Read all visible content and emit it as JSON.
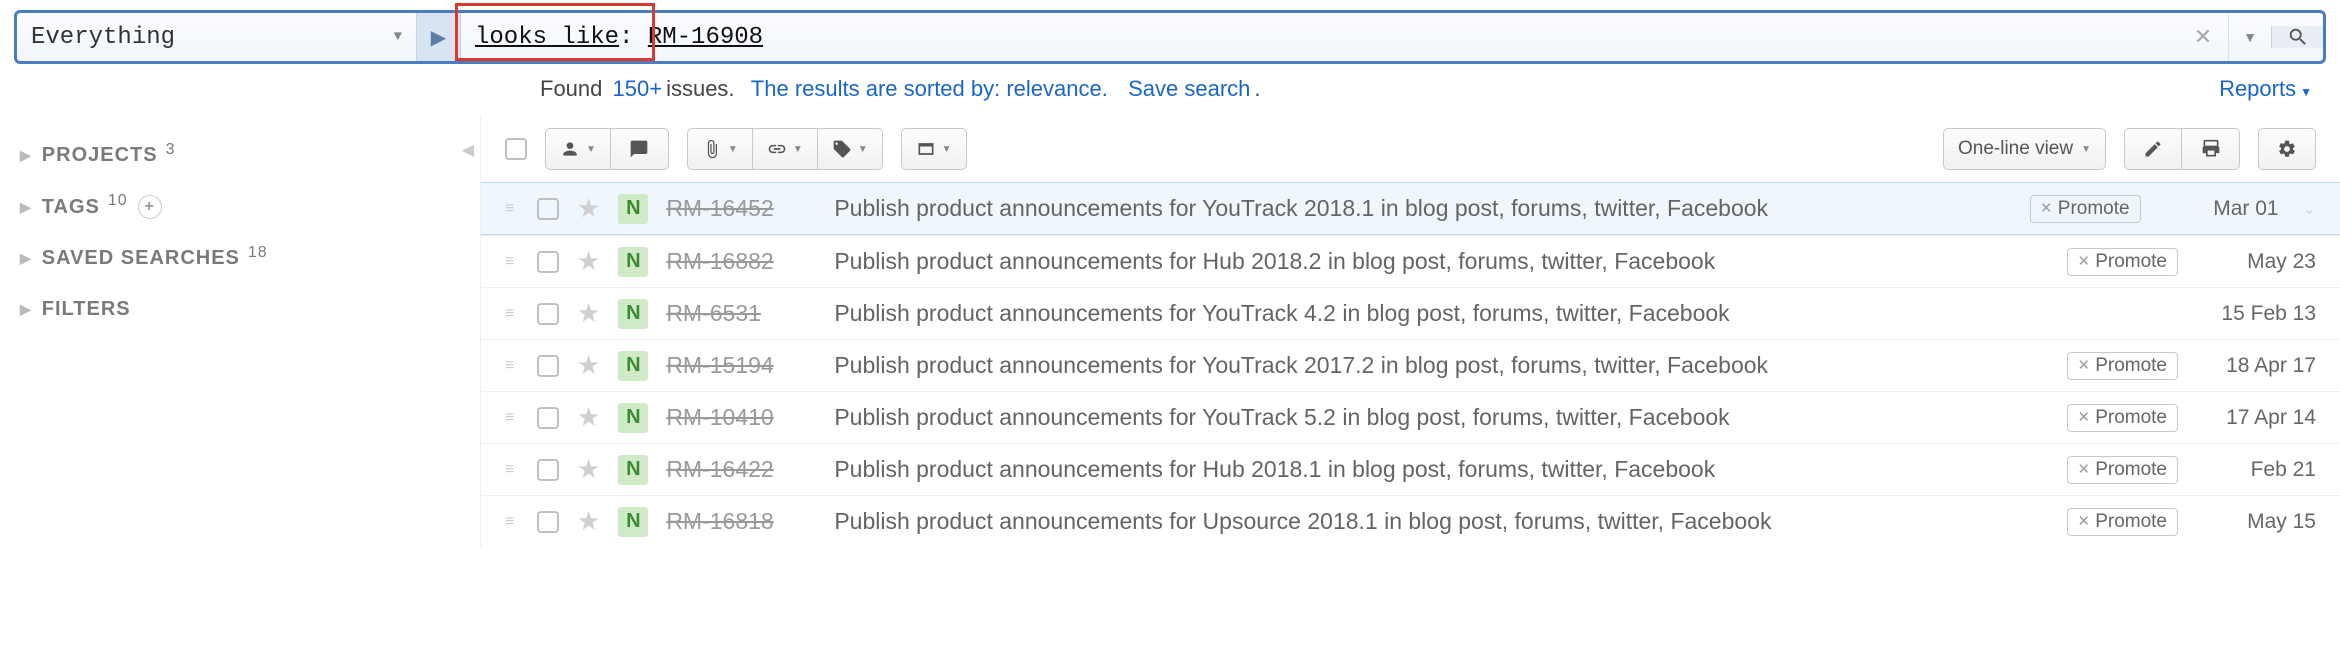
{
  "search": {
    "scope": "Everything",
    "query_operator": "looks like",
    "query_separator": ":",
    "query_value": "RM-16908"
  },
  "summary": {
    "prefix": "Found",
    "count": "150+",
    "count_suffix": "issues.",
    "sorted_text": "The results are sorted by: relevance.",
    "save_search": "Save search",
    "reports": "Reports"
  },
  "sidebar": {
    "sections": [
      {
        "label": "PROJECTS",
        "count": "3"
      },
      {
        "label": "TAGS",
        "count": "10",
        "add": true
      },
      {
        "label": "SAVED SEARCHES",
        "count": "18"
      },
      {
        "label": "FILTERS",
        "count": ""
      }
    ]
  },
  "toolbar": {
    "view_label": "One-line view"
  },
  "issues": [
    {
      "id": "RM-16452",
      "title": "Publish product announcements for YouTrack 2018.1 in blog post, forums, twitter, Facebook",
      "tag": "Promote",
      "date": "Mar 01",
      "selected": true
    },
    {
      "id": "RM-16882",
      "title": "Publish product announcements for Hub 2018.2 in blog post, forums, twitter, Facebook",
      "tag": "Promote",
      "date": "May 23"
    },
    {
      "id": "RM-6531",
      "title": "Publish product announcements for YouTrack 4.2 in blog post, forums, twitter, Facebook",
      "tag": "",
      "date": "15 Feb 13"
    },
    {
      "id": "RM-15194",
      "title": "Publish product announcements for YouTrack 2017.2 in blog post, forums, twitter, Facebook",
      "tag": "Promote",
      "date": "18 Apr 17"
    },
    {
      "id": "RM-10410",
      "title": "Publish product announcements for YouTrack 5.2 in blog post, forums, twitter, Facebook",
      "tag": "Promote",
      "date": "17 Apr 14"
    },
    {
      "id": "RM-16422",
      "title": "Publish product announcements for Hub 2018.1 in blog post, forums, twitter, Facebook",
      "tag": "Promote",
      "date": "Feb 21"
    },
    {
      "id": "RM-16818",
      "title": "Publish product announcements for Upsource 2018.1 in blog post, forums, twitter, Facebook",
      "tag": "Promote",
      "date": "May 15"
    }
  ]
}
